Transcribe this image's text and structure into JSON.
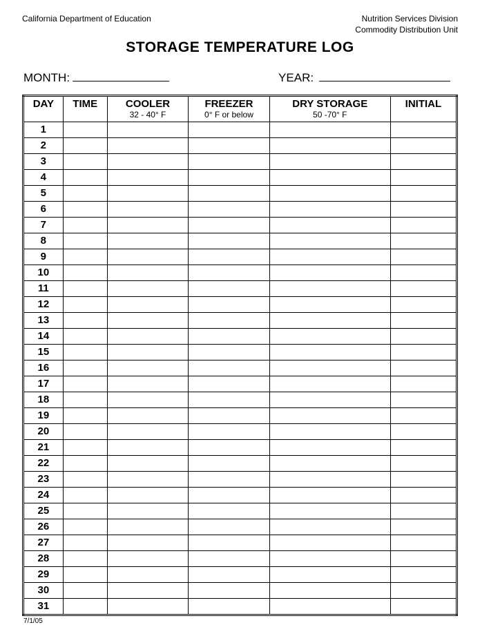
{
  "header": {
    "left": "California Department of Education",
    "right_line1": "Nutrition Services Division",
    "right_line2": "Commodity Distribution Unit"
  },
  "title": "STORAGE TEMPERATURE LOG",
  "meta": {
    "month_label": "MONTH:",
    "year_label": "YEAR:",
    "month_value": "",
    "year_value": ""
  },
  "columns": {
    "day": {
      "label": "DAY",
      "sub": ""
    },
    "time": {
      "label": "TIME",
      "sub": ""
    },
    "cooler": {
      "label": "COOLER",
      "sub": "32 - 40° F"
    },
    "freezer": {
      "label": "FREEZER",
      "sub": "0° F or below"
    },
    "dry": {
      "label": "DRY STORAGE",
      "sub": "50 -70° F"
    },
    "initial": {
      "label": "INITIAL",
      "sub": ""
    }
  },
  "rows": [
    {
      "day": "1",
      "time": "",
      "cooler": "",
      "freezer": "",
      "dry": "",
      "initial": ""
    },
    {
      "day": "2",
      "time": "",
      "cooler": "",
      "freezer": "",
      "dry": "",
      "initial": ""
    },
    {
      "day": "3",
      "time": "",
      "cooler": "",
      "freezer": "",
      "dry": "",
      "initial": ""
    },
    {
      "day": "4",
      "time": "",
      "cooler": "",
      "freezer": "",
      "dry": "",
      "initial": ""
    },
    {
      "day": "5",
      "time": "",
      "cooler": "",
      "freezer": "",
      "dry": "",
      "initial": ""
    },
    {
      "day": "6",
      "time": "",
      "cooler": "",
      "freezer": "",
      "dry": "",
      "initial": ""
    },
    {
      "day": "7",
      "time": "",
      "cooler": "",
      "freezer": "",
      "dry": "",
      "initial": ""
    },
    {
      "day": "8",
      "time": "",
      "cooler": "",
      "freezer": "",
      "dry": "",
      "initial": ""
    },
    {
      "day": "9",
      "time": "",
      "cooler": "",
      "freezer": "",
      "dry": "",
      "initial": ""
    },
    {
      "day": "10",
      "time": "",
      "cooler": "",
      "freezer": "",
      "dry": "",
      "initial": ""
    },
    {
      "day": "11",
      "time": "",
      "cooler": "",
      "freezer": "",
      "dry": "",
      "initial": ""
    },
    {
      "day": "12",
      "time": "",
      "cooler": "",
      "freezer": "",
      "dry": "",
      "initial": ""
    },
    {
      "day": "13",
      "time": "",
      "cooler": "",
      "freezer": "",
      "dry": "",
      "initial": ""
    },
    {
      "day": "14",
      "time": "",
      "cooler": "",
      "freezer": "",
      "dry": "",
      "initial": ""
    },
    {
      "day": "15",
      "time": "",
      "cooler": "",
      "freezer": "",
      "dry": "",
      "initial": ""
    },
    {
      "day": "16",
      "time": "",
      "cooler": "",
      "freezer": "",
      "dry": "",
      "initial": ""
    },
    {
      "day": "17",
      "time": "",
      "cooler": "",
      "freezer": "",
      "dry": "",
      "initial": ""
    },
    {
      "day": "18",
      "time": "",
      "cooler": "",
      "freezer": "",
      "dry": "",
      "initial": ""
    },
    {
      "day": "19",
      "time": "",
      "cooler": "",
      "freezer": "",
      "dry": "",
      "initial": ""
    },
    {
      "day": "20",
      "time": "",
      "cooler": "",
      "freezer": "",
      "dry": "",
      "initial": ""
    },
    {
      "day": "21",
      "time": "",
      "cooler": "",
      "freezer": "",
      "dry": "",
      "initial": ""
    },
    {
      "day": "22",
      "time": "",
      "cooler": "",
      "freezer": "",
      "dry": "",
      "initial": ""
    },
    {
      "day": "23",
      "time": "",
      "cooler": "",
      "freezer": "",
      "dry": "",
      "initial": ""
    },
    {
      "day": "24",
      "time": "",
      "cooler": "",
      "freezer": "",
      "dry": "",
      "initial": ""
    },
    {
      "day": "25",
      "time": "",
      "cooler": "",
      "freezer": "",
      "dry": "",
      "initial": ""
    },
    {
      "day": "26",
      "time": "",
      "cooler": "",
      "freezer": "",
      "dry": "",
      "initial": ""
    },
    {
      "day": "27",
      "time": "",
      "cooler": "",
      "freezer": "",
      "dry": "",
      "initial": ""
    },
    {
      "day": "28",
      "time": "",
      "cooler": "",
      "freezer": "",
      "dry": "",
      "initial": ""
    },
    {
      "day": "29",
      "time": "",
      "cooler": "",
      "freezer": "",
      "dry": "",
      "initial": ""
    },
    {
      "day": "30",
      "time": "",
      "cooler": "",
      "freezer": "",
      "dry": "",
      "initial": ""
    },
    {
      "day": "31",
      "time": "",
      "cooler": "",
      "freezer": "",
      "dry": "",
      "initial": ""
    }
  ],
  "footer_date": "7/1/05"
}
